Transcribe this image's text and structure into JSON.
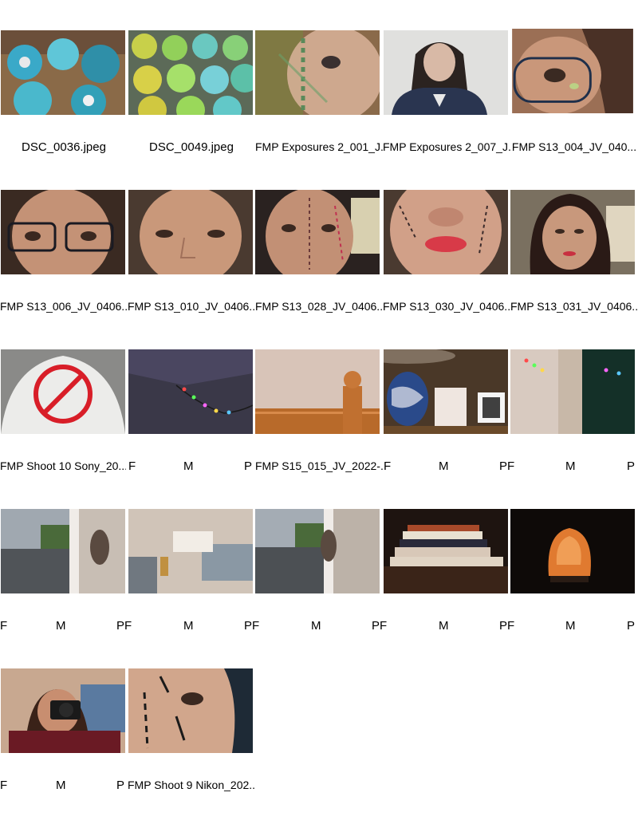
{
  "rows": [
    {
      "thumbs": [
        {
          "name": "DSC_0036.jpeg"
        },
        {
          "name": "DSC_0049.jpeg"
        },
        {
          "name": "FMP Exposures 2_001_J..."
        },
        {
          "name": "FMP Exposures 2_007_J..."
        },
        {
          "name": "FMP S13_004_JV_040..."
        }
      ]
    },
    {
      "thumbs": [
        {
          "name": "FMP S13_006_JV_0406..."
        },
        {
          "name": "FMP S13_010_JV_0406..."
        },
        {
          "name": "FMP S13_028_JV_0406..."
        },
        {
          "name": "FMP S13_030_JV_0406..."
        },
        {
          "name": "FMP S13_031_JV_0406..."
        }
      ]
    },
    {
      "captions": {
        "c1": "FMP Shoot 10 Sony_20...",
        "c3": "FMP S15_015_JV_2022-...",
        "letters": [
          "F",
          "M",
          "P",
          "F",
          "M",
          "PF",
          "M",
          "P"
        ]
      }
    },
    {
      "letters": [
        "F",
        "M",
        "PF",
        "M",
        "PF",
        "M",
        "PF",
        "M",
        "PF",
        "M",
        "P"
      ]
    },
    {
      "letters": [
        "F",
        "M",
        "P"
      ],
      "caption": "FMP Shoot 9 Nikon_202..."
    }
  ]
}
